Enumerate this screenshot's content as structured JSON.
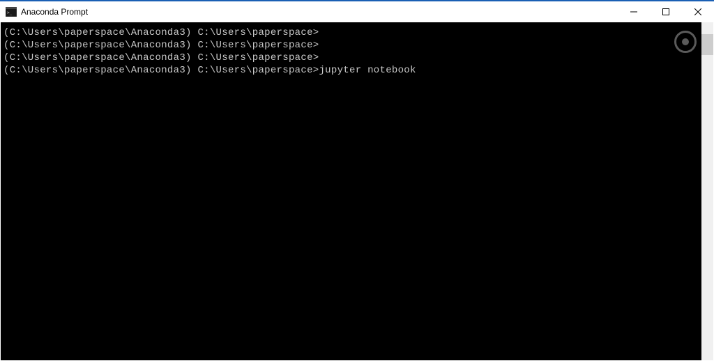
{
  "window": {
    "title": "Anaconda Prompt"
  },
  "terminal": {
    "lines": [
      {
        "prompt": "(C:\\Users\\paperspace\\Anaconda3) C:\\Users\\paperspace>",
        "command": ""
      },
      {
        "prompt": "(C:\\Users\\paperspace\\Anaconda3) C:\\Users\\paperspace>",
        "command": ""
      },
      {
        "prompt": "(C:\\Users\\paperspace\\Anaconda3) C:\\Users\\paperspace>",
        "command": ""
      },
      {
        "prompt": "(C:\\Users\\paperspace\\Anaconda3) C:\\Users\\paperspace>",
        "command": "jupyter notebook"
      }
    ]
  },
  "icons": {
    "app": "console-icon",
    "minimize": "minimize-icon",
    "maximize": "maximize-icon",
    "close": "close-icon"
  }
}
